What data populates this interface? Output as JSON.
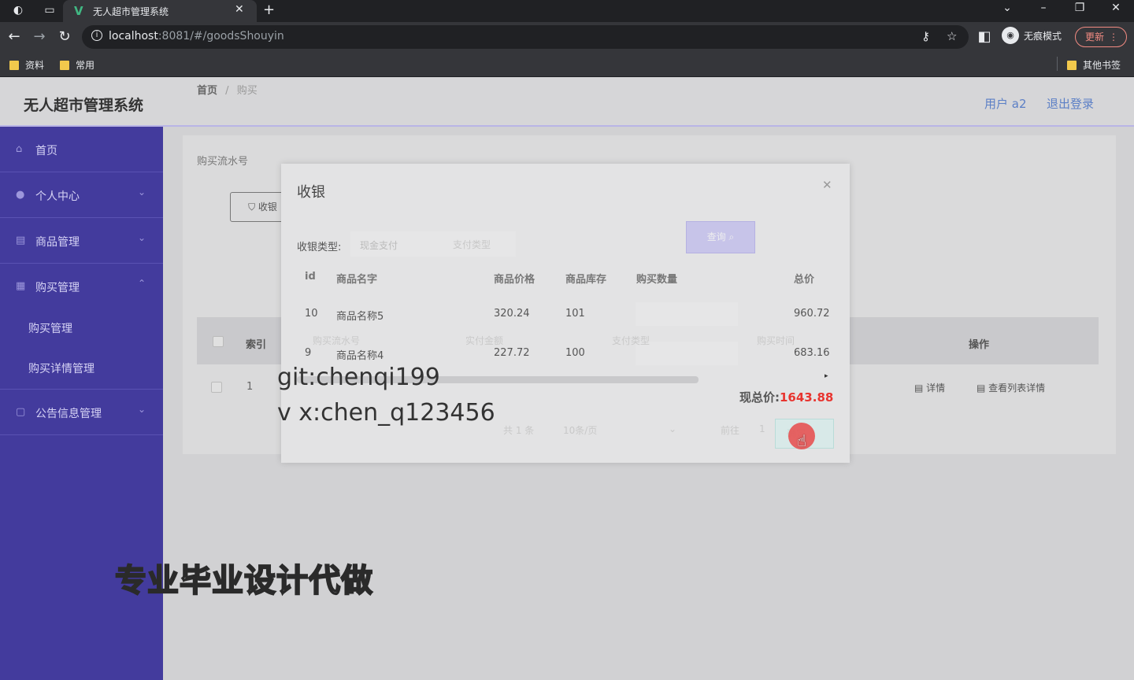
{
  "browser": {
    "tab_title": "无人超市管理系统",
    "url_host": "localhost",
    "url_rest": ":8081/#/goodsShouyin",
    "incognito_label": "无痕模式",
    "update_label": "更新",
    "bookmarks": [
      "资料",
      "常用"
    ],
    "other_bookmarks": "其他书签"
  },
  "header": {
    "title": "无人超市管理系统",
    "user": "用户 a2",
    "logout": "退出登录"
  },
  "sidebar": {
    "items": [
      {
        "label": "首页",
        "icon": "home-icon"
      },
      {
        "label": "个人中心",
        "icon": "user-icon"
      },
      {
        "label": "商品管理",
        "icon": "goods-icon"
      },
      {
        "label": "购买管理",
        "icon": "purchase-icon"
      },
      {
        "label": "公告信息管理",
        "icon": "notice-icon"
      }
    ],
    "sub_items": [
      "购买管理",
      "购买详情管理"
    ]
  },
  "page": {
    "breadcrumb_home": "首页",
    "breadcrumb_sep": "/",
    "breadcrumb_current": "购买",
    "search_label": "购买流水号",
    "cashier_button": "收银",
    "table_headers": {
      "index": "索引",
      "ops": "操作"
    },
    "row": {
      "index": "1",
      "detail": "详情",
      "list_detail": "查看列表详情"
    }
  },
  "modal": {
    "title": "收银",
    "pay_type_label": "收银类型:",
    "pay_type_value": "现金支付",
    "pay_type_ghost": "支付类型",
    "query_button": "查询",
    "columns": [
      "id",
      "商品名字",
      "商品价格",
      "商品库存",
      "购买数量",
      "总价"
    ],
    "rows": [
      {
        "id": "10",
        "name": "商品名称5",
        "price": "320.24",
        "stock": "101",
        "total": "960.72"
      },
      {
        "id": "9",
        "name": "商品名称4",
        "price": "227.72",
        "stock": "100",
        "total": "683.16"
      }
    ],
    "ghost_columns": [
      "购买流水号",
      "实付金额",
      "支付类型",
      "购买时间"
    ],
    "total_label": "现总价:",
    "total_value": "1643.88",
    "pager_total": "共 1 条",
    "pager_size": "10条/页",
    "pager_goto": "前往",
    "pager_page": "1",
    "confirm_button": "确定"
  },
  "overlay": {
    "line1": "git:chenqi199",
    "line2": "v x:chen_q123456",
    "banner": "专业毕业设计代做"
  }
}
